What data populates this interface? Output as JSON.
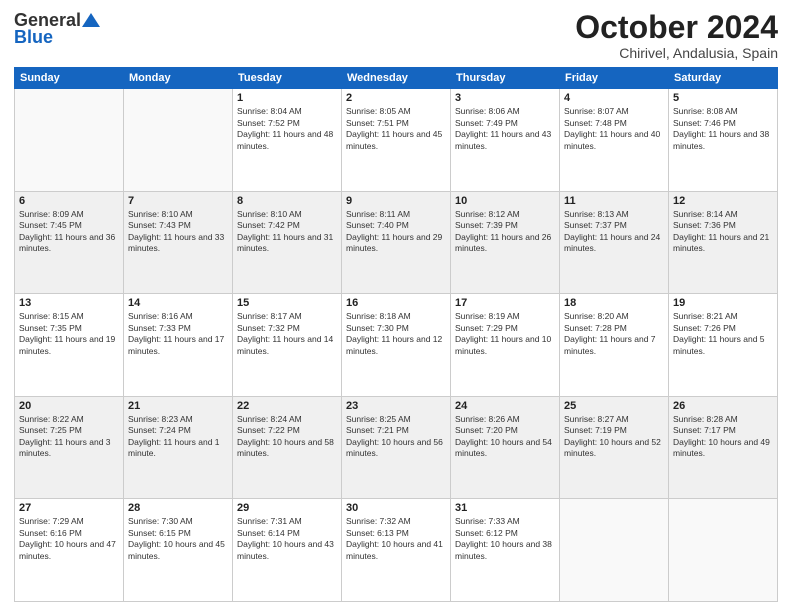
{
  "logo": {
    "line1": "General",
    "line2": "Blue",
    "icon": "▲"
  },
  "title": "October 2024",
  "subtitle": "Chirivel, Andalusia, Spain",
  "headers": [
    "Sunday",
    "Monday",
    "Tuesday",
    "Wednesday",
    "Thursday",
    "Friday",
    "Saturday"
  ],
  "rows": [
    [
      {
        "day": "",
        "info": ""
      },
      {
        "day": "",
        "info": ""
      },
      {
        "day": "1",
        "info": "Sunrise: 8:04 AM\nSunset: 7:52 PM\nDaylight: 11 hours and 48 minutes."
      },
      {
        "day": "2",
        "info": "Sunrise: 8:05 AM\nSunset: 7:51 PM\nDaylight: 11 hours and 45 minutes."
      },
      {
        "day": "3",
        "info": "Sunrise: 8:06 AM\nSunset: 7:49 PM\nDaylight: 11 hours and 43 minutes."
      },
      {
        "day": "4",
        "info": "Sunrise: 8:07 AM\nSunset: 7:48 PM\nDaylight: 11 hours and 40 minutes."
      },
      {
        "day": "5",
        "info": "Sunrise: 8:08 AM\nSunset: 7:46 PM\nDaylight: 11 hours and 38 minutes."
      }
    ],
    [
      {
        "day": "6",
        "info": "Sunrise: 8:09 AM\nSunset: 7:45 PM\nDaylight: 11 hours and 36 minutes."
      },
      {
        "day": "7",
        "info": "Sunrise: 8:10 AM\nSunset: 7:43 PM\nDaylight: 11 hours and 33 minutes."
      },
      {
        "day": "8",
        "info": "Sunrise: 8:10 AM\nSunset: 7:42 PM\nDaylight: 11 hours and 31 minutes."
      },
      {
        "day": "9",
        "info": "Sunrise: 8:11 AM\nSunset: 7:40 PM\nDaylight: 11 hours and 29 minutes."
      },
      {
        "day": "10",
        "info": "Sunrise: 8:12 AM\nSunset: 7:39 PM\nDaylight: 11 hours and 26 minutes."
      },
      {
        "day": "11",
        "info": "Sunrise: 8:13 AM\nSunset: 7:37 PM\nDaylight: 11 hours and 24 minutes."
      },
      {
        "day": "12",
        "info": "Sunrise: 8:14 AM\nSunset: 7:36 PM\nDaylight: 11 hours and 21 minutes."
      }
    ],
    [
      {
        "day": "13",
        "info": "Sunrise: 8:15 AM\nSunset: 7:35 PM\nDaylight: 11 hours and 19 minutes."
      },
      {
        "day": "14",
        "info": "Sunrise: 8:16 AM\nSunset: 7:33 PM\nDaylight: 11 hours and 17 minutes."
      },
      {
        "day": "15",
        "info": "Sunrise: 8:17 AM\nSunset: 7:32 PM\nDaylight: 11 hours and 14 minutes."
      },
      {
        "day": "16",
        "info": "Sunrise: 8:18 AM\nSunset: 7:30 PM\nDaylight: 11 hours and 12 minutes."
      },
      {
        "day": "17",
        "info": "Sunrise: 8:19 AM\nSunset: 7:29 PM\nDaylight: 11 hours and 10 minutes."
      },
      {
        "day": "18",
        "info": "Sunrise: 8:20 AM\nSunset: 7:28 PM\nDaylight: 11 hours and 7 minutes."
      },
      {
        "day": "19",
        "info": "Sunrise: 8:21 AM\nSunset: 7:26 PM\nDaylight: 11 hours and 5 minutes."
      }
    ],
    [
      {
        "day": "20",
        "info": "Sunrise: 8:22 AM\nSunset: 7:25 PM\nDaylight: 11 hours and 3 minutes."
      },
      {
        "day": "21",
        "info": "Sunrise: 8:23 AM\nSunset: 7:24 PM\nDaylight: 11 hours and 1 minute."
      },
      {
        "day": "22",
        "info": "Sunrise: 8:24 AM\nSunset: 7:22 PM\nDaylight: 10 hours and 58 minutes."
      },
      {
        "day": "23",
        "info": "Sunrise: 8:25 AM\nSunset: 7:21 PM\nDaylight: 10 hours and 56 minutes."
      },
      {
        "day": "24",
        "info": "Sunrise: 8:26 AM\nSunset: 7:20 PM\nDaylight: 10 hours and 54 minutes."
      },
      {
        "day": "25",
        "info": "Sunrise: 8:27 AM\nSunset: 7:19 PM\nDaylight: 10 hours and 52 minutes."
      },
      {
        "day": "26",
        "info": "Sunrise: 8:28 AM\nSunset: 7:17 PM\nDaylight: 10 hours and 49 minutes."
      }
    ],
    [
      {
        "day": "27",
        "info": "Sunrise: 7:29 AM\nSunset: 6:16 PM\nDaylight: 10 hours and 47 minutes."
      },
      {
        "day": "28",
        "info": "Sunrise: 7:30 AM\nSunset: 6:15 PM\nDaylight: 10 hours and 45 minutes."
      },
      {
        "day": "29",
        "info": "Sunrise: 7:31 AM\nSunset: 6:14 PM\nDaylight: 10 hours and 43 minutes."
      },
      {
        "day": "30",
        "info": "Sunrise: 7:32 AM\nSunset: 6:13 PM\nDaylight: 10 hours and 41 minutes."
      },
      {
        "day": "31",
        "info": "Sunrise: 7:33 AM\nSunset: 6:12 PM\nDaylight: 10 hours and 38 minutes."
      },
      {
        "day": "",
        "info": ""
      },
      {
        "day": "",
        "info": ""
      }
    ]
  ]
}
